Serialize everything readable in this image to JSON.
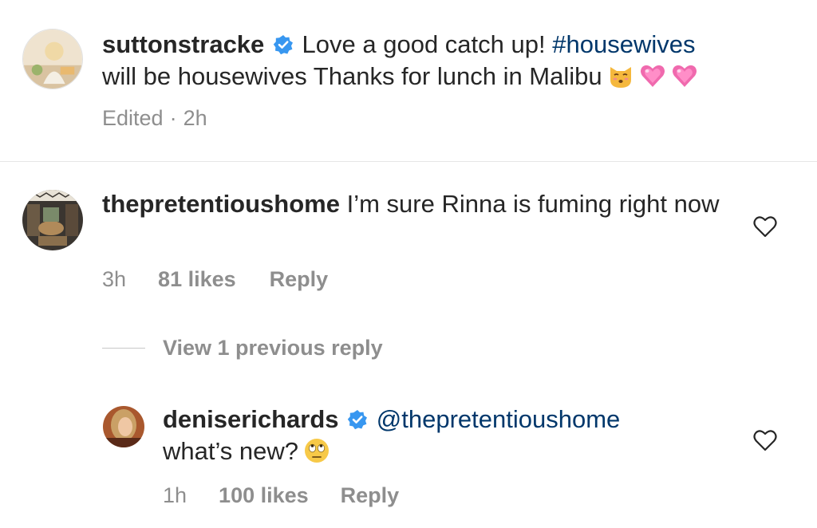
{
  "caption": {
    "username": "suttonstracke",
    "text_before_tag": "Love a good catch up! ",
    "hashtag": "#housewives",
    "text_after_tag": "will be housewives Thanks for lunch in Malibu",
    "emojis": [
      "kissing-cat-emoji",
      "pink-heart-emoji",
      "pink-heart-emoji"
    ],
    "edited_label": "Edited",
    "separator": "·",
    "time": "2h",
    "verified": true
  },
  "comments": [
    {
      "username": "thepretentioushome",
      "text": "I’m sure Rinna is fuming right now",
      "time": "3h",
      "likes": "81 likes",
      "reply_label": "Reply",
      "verified": false
    }
  ],
  "view_replies": {
    "label": "View 1 previous reply"
  },
  "reply": {
    "username": "deniserichards",
    "mention": "@thepretentioushome",
    "text": "what’s new?",
    "emoji": "rolling-eyes-emoji",
    "time": "1h",
    "likes": "100 likes",
    "reply_label": "Reply",
    "verified": true
  },
  "colors": {
    "text": "#262626",
    "secondary": "#8e8e8e",
    "link": "#00376b",
    "verified": "#3897f0"
  }
}
